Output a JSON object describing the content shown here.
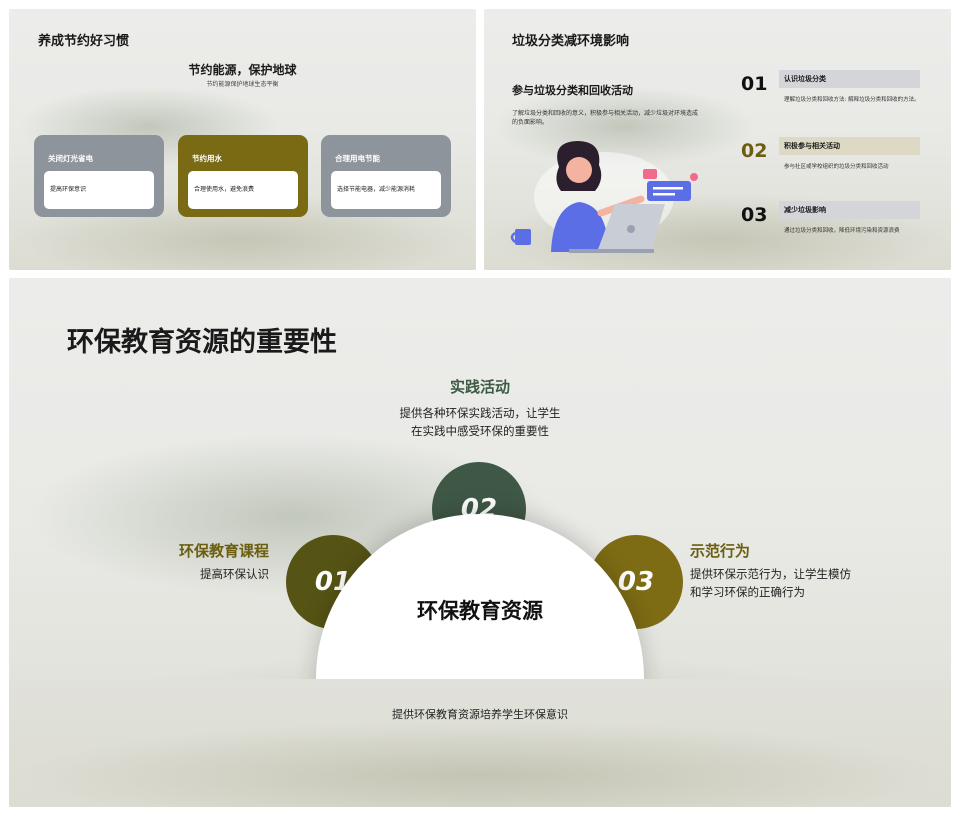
{
  "slide1": {
    "title": "养成节约好习惯",
    "subtitle": "节约能源，保护地球",
    "subtitle_desc": "节约能源保护地球生态平衡",
    "cards": [
      {
        "title": "关闭灯光省电",
        "body": "提高环保意识",
        "color": "#8e949c"
      },
      {
        "title": "节约用水",
        "body": "合理使用水，避免浪费",
        "color": "#7a6a14"
      },
      {
        "title": "合理用电节能",
        "body": "选择节能电器，减少能源消耗",
        "color": "#8e949c"
      }
    ]
  },
  "slide2": {
    "title": "垃圾分类减环境影响",
    "left_heading": "参与垃圾分类和回收活动",
    "left_desc": "了解垃圾分类和回收的意义，积极参与相关活动，减少垃圾对环境造成的负面影响。",
    "steps": [
      {
        "num": "01",
        "tag": "认识垃圾分类",
        "desc": "理解垃圾分类和回收方法: 解释垃圾分类和回收的方法。"
      },
      {
        "num": "02",
        "tag": "积极参与相关活动",
        "desc": "参与社区或学校组织的垃圾分类和回收活动"
      },
      {
        "num": "03",
        "tag": "减少垃圾影响",
        "desc": "通过垃圾分类和回收，降低环境污染和资源浪费"
      }
    ]
  },
  "slide3": {
    "title": "环保教育资源的重要性",
    "center_label": "环保教育资源",
    "caption": "提供环保教育资源培养学生环保意识",
    "items": [
      {
        "num": "01",
        "heading": "环保教育课程",
        "desc": "提高环保认识"
      },
      {
        "num": "02",
        "heading": "实践活动",
        "desc_line1": "提供各种环保实践活动，让学生",
        "desc_line2": "在实践中感受环保的重要性"
      },
      {
        "num": "03",
        "heading": "示范行为",
        "desc_line1": "提供环保示范行为，让学生模仿",
        "desc_line2": "和学习环保的正确行为"
      }
    ],
    "colors": {
      "olive_dark": "#565414",
      "green_dark": "#3f5846",
      "olive": "#7d6c14"
    }
  }
}
